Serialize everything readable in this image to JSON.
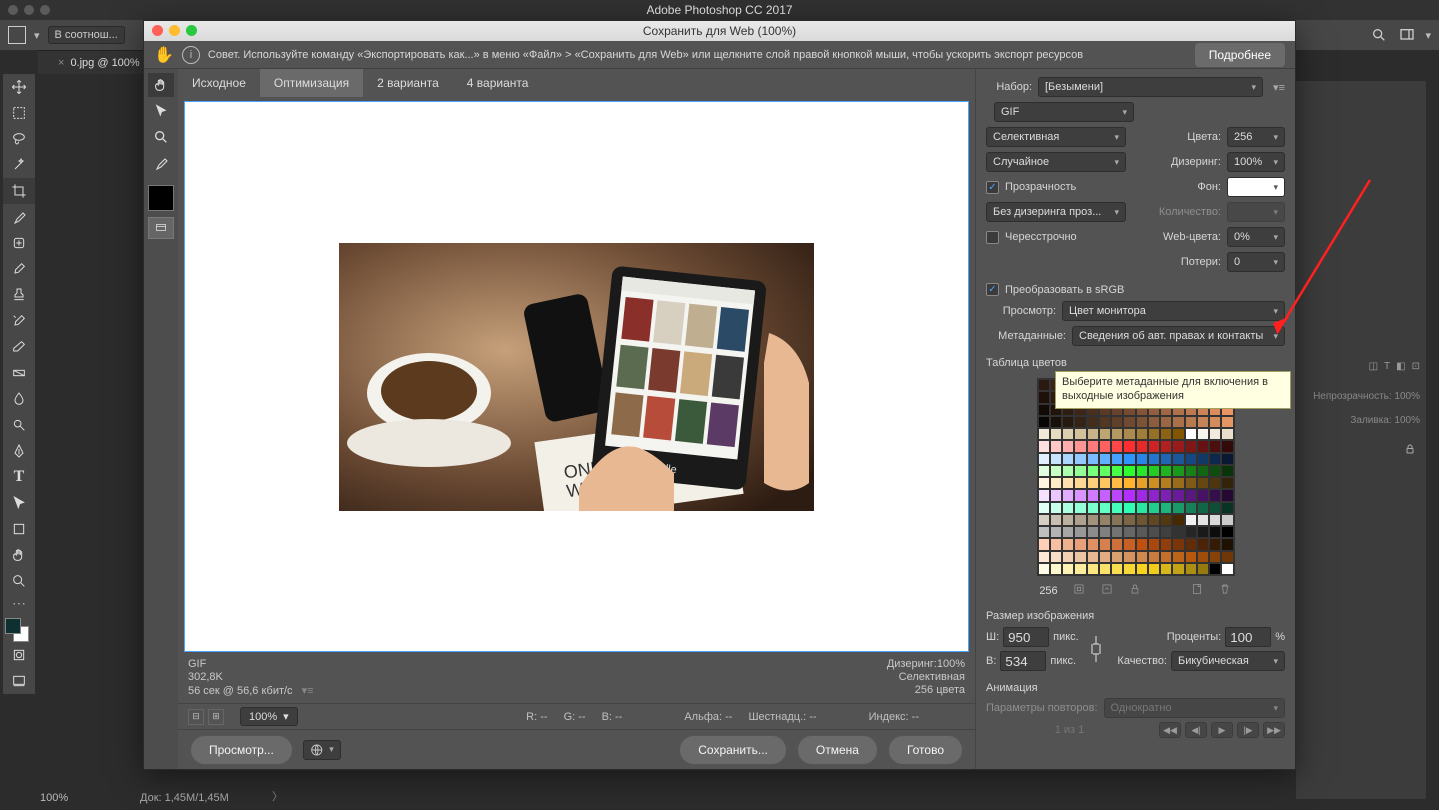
{
  "app": {
    "title": "Adobe Photoshop CC 2017"
  },
  "doc": {
    "tab": "0.jpg @ 100%",
    "zoom": "100%",
    "docsize": "Док: 1,45M/1,45M"
  },
  "host_options": {
    "ratio": "В соотнош..."
  },
  "dialog": {
    "title": "Сохранить для Web (100%)",
    "tip": "Совет. Используйте команду «Экспортировать как...» в меню «Файл» > «Сохранить для Web» или щелкните слой правой кнопкой мыши, чтобы ускорить экспорт ресурсов",
    "more": "Подробнее",
    "tabs": {
      "source": "Исходное",
      "opt": "Оптимизация",
      "two": "2 варианта",
      "four": "4 варианта"
    },
    "footer_info_left": {
      "format": "GIF",
      "size": "302,8K",
      "time": "56 сек @ 56,6 кбит/с"
    },
    "footer_info_right": {
      "dither": "Дизеринг:100%",
      "palette": "Селективная",
      "colors": "256 цвета"
    },
    "readouts": {
      "zoom": "100%",
      "R": "R: --",
      "G": "G: --",
      "B": "B: --",
      "alpha": "Альфа: --",
      "hex": "Шестнадц.: --",
      "index": "Индекс: --"
    },
    "buttons": {
      "preview": "Просмотр...",
      "save": "Сохранить...",
      "cancel": "Отмена",
      "done": "Готово"
    }
  },
  "settings": {
    "preset_label": "Набор:",
    "preset": "[Безымени]",
    "format": "GIF",
    "palette": "Селективная",
    "dither_alg": "Случайное",
    "transparency_label": "Прозрачность",
    "transp_dither": "Без дизеринга проз...",
    "interlaced_label": "Чересстрочно",
    "colors_label": "Цвета:",
    "colors": "256",
    "dither_label": "Дизеринг:",
    "dither": "100%",
    "matte_label": "Фон:",
    "amount_label": "Количество:",
    "websnap_label": "Web-цвета:",
    "websnap": "0%",
    "lossy_label": "Потери:",
    "lossy": "0",
    "srgb_label": "Преобразовать в sRGB",
    "preview_label": "Просмотр:",
    "preview": "Цвет монитора",
    "metadata_label": "Метаданные:",
    "metadata": "Сведения об авт. правах и контакты",
    "color_table_label": "Таблица цветов",
    "color_count": "256",
    "imagesize_label": "Размер изображения",
    "width_label": "Ш:",
    "width": "950",
    "height_label": "В:",
    "height": "534",
    "px": "пикс.",
    "percent_label": "Проценты:",
    "percent": "100",
    "percent_unit": "%",
    "quality_label": "Качество:",
    "quality": "Бикубическая",
    "animation_label": "Анимация",
    "loop_label": "Параметры повторов:",
    "loop": "Однократно",
    "frames": "1 из 1"
  },
  "tooltip": "Выберите метаданные для включения в выходные изображения",
  "right_panels": {
    "opacity_label": "Непрозрачность:",
    "opacity": "100%",
    "fill_label": "Заливка:",
    "fill": "100%"
  },
  "color_table_swatches": [
    "#2b1a12",
    "#3c2417",
    "#4a2d1d",
    "#583626",
    "#674030",
    "#75493a",
    "#845345",
    "#935d50",
    "#a2675b",
    "#b17166",
    "#bf7b71",
    "#ce857c",
    "#dd8f87",
    "#ec9992",
    "#fba39d",
    "#f5ada8",
    "#1f1109",
    "#2d1a10",
    "#3b2317",
    "#4a2d1f",
    "#583627",
    "#67402f",
    "#754937",
    "#84533f",
    "#935d47",
    "#a2674f",
    "#b17157",
    "#bf7b5f",
    "#ce8567",
    "#dd8f6f",
    "#ec9977",
    "#fba37f",
    "#120b05",
    "#20140b",
    "#2e1d11",
    "#3d2618",
    "#4b2f1e",
    "#5a3925",
    "#68422b",
    "#774b32",
    "#855438",
    "#945d3f",
    "#a26645",
    "#b1704c",
    "#bf7952",
    "#ce8259",
    "#dc8b5f",
    "#eb9466",
    "#0a0603",
    "#181009",
    "#261a0f",
    "#352416",
    "#432d1c",
    "#523723",
    "#604029",
    "#6f4a30",
    "#7d5336",
    "#8c5d3d",
    "#9a6643",
    "#a9704a",
    "#b77950",
    "#c68357",
    "#d48c5d",
    "#e39664",
    "#f0ead6",
    "#e6dcc2",
    "#dccfaf",
    "#d2c19b",
    "#c8b488",
    "#bea674",
    "#b49961",
    "#aa8b4d",
    "#a07e3a",
    "#967026",
    "#8c6313",
    "#825500",
    "#ffffff",
    "#f8f4ed",
    "#f1e9db",
    "#eadfca",
    "#ffe0e0",
    "#ffc7c7",
    "#ffadad",
    "#ff9494",
    "#ff7a7a",
    "#ff6161",
    "#ff4747",
    "#ff2e2e",
    "#e62929",
    "#cc2424",
    "#b32020",
    "#991b1b",
    "#801717",
    "#661212",
    "#4d0e0e",
    "#330909",
    "#e0f0ff",
    "#c7e3ff",
    "#add6ff",
    "#94c9ff",
    "#7abcff",
    "#61afff",
    "#47a2ff",
    "#2e95ff",
    "#2985e6",
    "#2476cc",
    "#2066b3",
    "#1b5799",
    "#174780",
    "#123866",
    "#0e284d",
    "#091933",
    "#e0ffe0",
    "#c7ffc7",
    "#adffad",
    "#94ff94",
    "#7aff7a",
    "#61ff61",
    "#47ff47",
    "#2eff2e",
    "#29e629",
    "#24cc24",
    "#20b320",
    "#1b991b",
    "#178017",
    "#126612",
    "#0e4d0e",
    "#093309",
    "#fff5e0",
    "#ffecc7",
    "#ffe2ad",
    "#ffd994",
    "#ffcf7a",
    "#ffc661",
    "#ffbc47",
    "#ffb32e",
    "#e6a129",
    "#cc8f24",
    "#b37d20",
    "#996b1b",
    "#805917",
    "#664712",
    "#4d360e",
    "#332409",
    "#f5e0ff",
    "#ecc7ff",
    "#e2adff",
    "#d994ff",
    "#cf7aff",
    "#c661ff",
    "#bc47ff",
    "#b32eff",
    "#a129e6",
    "#8f24cc",
    "#7d20b3",
    "#6b1b99",
    "#591780",
    "#471266",
    "#360e4d",
    "#240933",
    "#e0fff5",
    "#c7ffec",
    "#adffe2",
    "#94ffd9",
    "#7affcf",
    "#61ffc6",
    "#47ffbc",
    "#2effb3",
    "#29e6a1",
    "#24cc8f",
    "#20b37d",
    "#1b996b",
    "#178059",
    "#126647",
    "#0e4d36",
    "#093324",
    "#d6cec3",
    "#c9bfb1",
    "#bcb09f",
    "#afa18d",
    "#a2927b",
    "#958369",
    "#887457",
    "#7b6545",
    "#6e5633",
    "#614721",
    "#54380f",
    "#472900",
    "#f2f2f2",
    "#e5e5e5",
    "#d9d9d9",
    "#cccccc",
    "#bfbfbf",
    "#b3b3b3",
    "#a6a6a6",
    "#999999",
    "#8c8c8c",
    "#808080",
    "#737373",
    "#666666",
    "#595959",
    "#4d4d4d",
    "#404040",
    "#333333",
    "#262626",
    "#1a1a1a",
    "#0d0d0d",
    "#000000",
    "#ffd0b8",
    "#f7c0a3",
    "#efb08e",
    "#e7a079",
    "#df9064",
    "#d7804f",
    "#cf703a",
    "#c76025",
    "#bf5010",
    "#a8470e",
    "#913e0c",
    "#7a350a",
    "#632c08",
    "#4c2306",
    "#351a04",
    "#1e1102",
    "#ffe8d6",
    "#f9dcc5",
    "#f3d0b4",
    "#edc4a3",
    "#e7b892",
    "#e1ac81",
    "#dba070",
    "#d5945f",
    "#cf884e",
    "#c97c3d",
    "#c3702c",
    "#bd641b",
    "#b7580a",
    "#9f4d09",
    "#874208",
    "#6f3707",
    "#fffbe6",
    "#fef6cd",
    "#fdf1b4",
    "#fcec9b",
    "#fbe782",
    "#fae269",
    "#f9dd50",
    "#f8d837",
    "#f7d31e",
    "#f0cc1b",
    "#d9b718",
    "#c2a315",
    "#ab8e12",
    "#947a0f",
    "#000000",
    "#ffffff"
  ]
}
